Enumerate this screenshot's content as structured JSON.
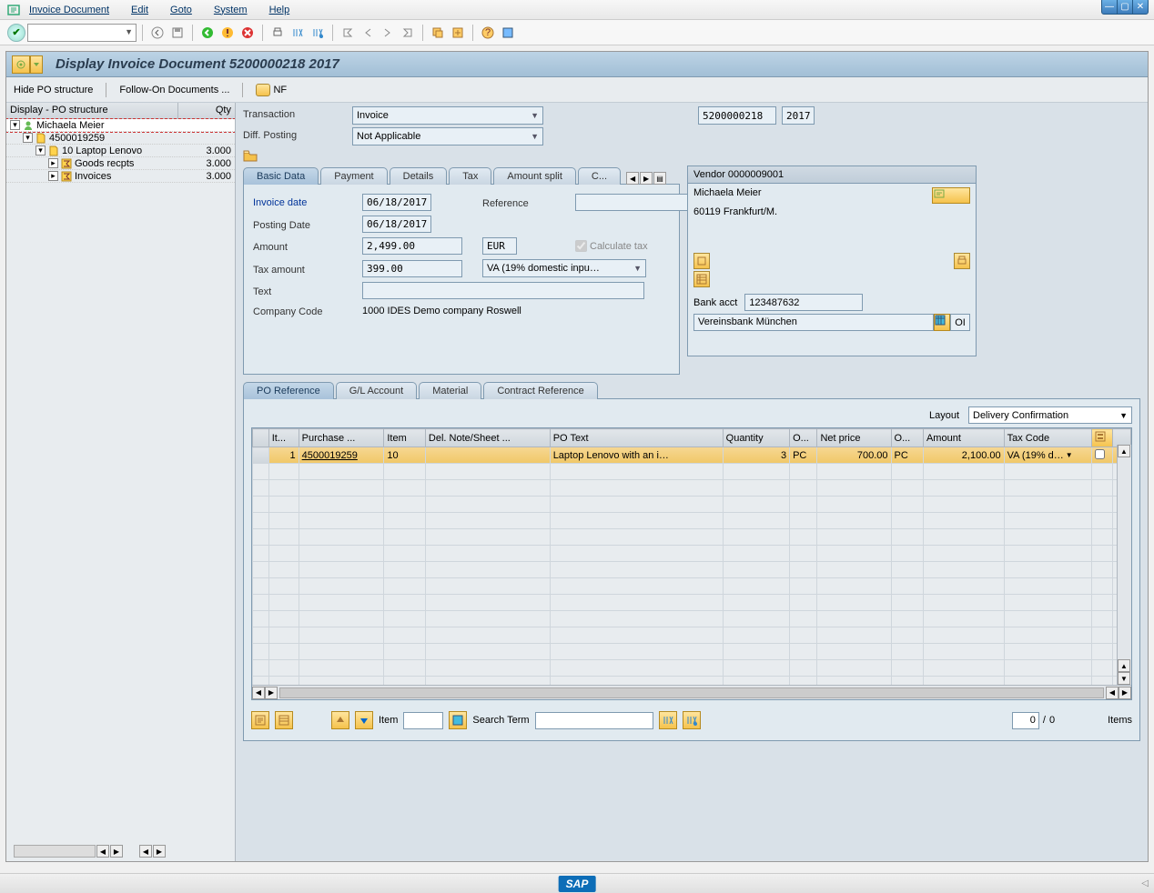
{
  "menu": {
    "items": [
      "Invoice Document",
      "Edit",
      "Goto",
      "System",
      "Help"
    ]
  },
  "title": "Display Invoice Document 5200000218 2017",
  "actionbar": {
    "hide_po": "Hide PO structure",
    "follow_on": "Follow-On Documents ...",
    "nf": "NF"
  },
  "po_tree": {
    "header_label": "Display - PO structure",
    "header_qty": "Qty",
    "rows": [
      {
        "indent": 0,
        "toggle": "▾",
        "icon": "person",
        "label": "Michaela Meier",
        "qty": "",
        "selected": true
      },
      {
        "indent": 1,
        "toggle": "▾",
        "icon": "doc",
        "label": "4500019259",
        "qty": ""
      },
      {
        "indent": 2,
        "toggle": "▾",
        "icon": "doc",
        "label": "10 Laptop Lenovo",
        "qty": "3.000"
      },
      {
        "indent": 3,
        "toggle": "▸",
        "icon": "sigma",
        "label": "Goods recpts",
        "qty": "3.000"
      },
      {
        "indent": 3,
        "toggle": "▸",
        "icon": "sigma",
        "label": "Invoices",
        "qty": "3.000"
      }
    ]
  },
  "header_form": {
    "transaction_label": "Transaction",
    "transaction_value": "Invoice",
    "diff_posting_label": "Diff. Posting",
    "diff_posting_value": "Not Applicable",
    "doc_number": "5200000218",
    "fiscal_year": "2017"
  },
  "tabs_main": [
    "Basic Data",
    "Payment",
    "Details",
    "Tax",
    "Amount split",
    "C..."
  ],
  "basic_data": {
    "invoice_date_label": "Invoice date",
    "invoice_date": "06/18/2017",
    "reference_label": "Reference",
    "reference": "",
    "posting_date_label": "Posting Date",
    "posting_date": "06/18/2017",
    "amount_label": "Amount",
    "amount": "2,499.00",
    "currency": "EUR",
    "calc_tax_label": "Calculate tax",
    "tax_amount_label": "Tax amount",
    "tax_amount": "399.00",
    "tax_code_value": "VA (19% domestic inpu…",
    "text_label": "Text",
    "text": "",
    "company_code_label": "Company Code",
    "company_code": "1000 IDES Demo company Roswell"
  },
  "vendor": {
    "header": "Vendor 0000009001",
    "name": "Michaela Meier",
    "city": "60119 Frankfurt/M.",
    "bank_acct_label": "Bank acct",
    "bank_acct": "123487632",
    "bank_name": "Vereinsbank München",
    "oi": "OI"
  },
  "tabs_lower": [
    "PO Reference",
    "G/L Account",
    "Material",
    "Contract Reference"
  ],
  "layout": {
    "label": "Layout",
    "value": "Delivery Confirmation"
  },
  "grid": {
    "columns": [
      "It...",
      "Purchase ...",
      "Item",
      "Del. Note/Sheet ...",
      "PO Text",
      "Quantity",
      "O...",
      "Net price",
      "O...",
      "Amount",
      "Tax Code",
      ""
    ],
    "row": {
      "item_no": "1",
      "purchase": "4500019259",
      "item": "10",
      "del_note": "",
      "po_text": "Laptop Lenovo with an i…",
      "quantity": "3",
      "ou1": "PC",
      "net_price": "700.00",
      "ou2": "PC",
      "amount": "2,100.00",
      "tax_code": "VA (19% d…"
    }
  },
  "search_bar": {
    "item_label": "Item",
    "search_term_label": "Search Term",
    "count_value": "0",
    "count_sep": "/",
    "count_total": "0",
    "items_label": "Items"
  }
}
